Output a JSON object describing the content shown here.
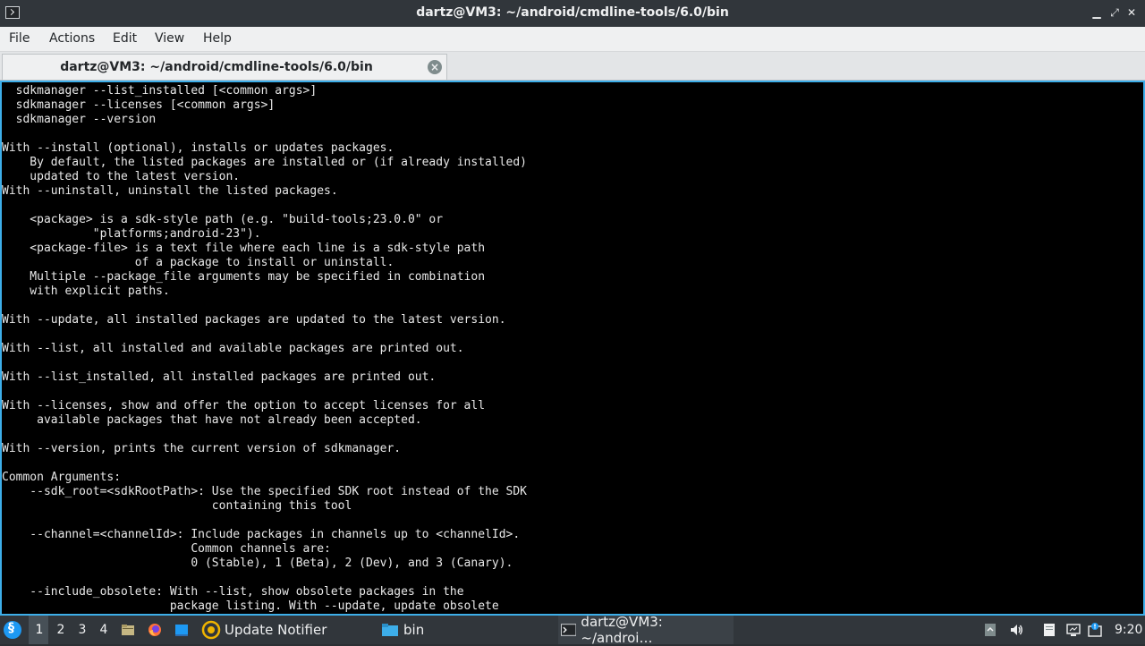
{
  "window": {
    "title": "dartz@VM3: ~/android/cmdline-tools/6.0/bin",
    "controls": {
      "minimize": "▁",
      "maximize": "⤢",
      "close": "✕"
    }
  },
  "menu": {
    "items": [
      "File",
      "Actions",
      "Edit",
      "View",
      "Help"
    ]
  },
  "tab": {
    "title": "dartz@VM3: ~/android/cmdline-tools/6.0/bin",
    "close": "×"
  },
  "terminal": {
    "lines": [
      "  sdkmanager --list_installed [<common args>]",
      "  sdkmanager --licenses [<common args>]",
      "  sdkmanager --version",
      "",
      "With --install (optional), installs or updates packages.",
      "    By default, the listed packages are installed or (if already installed)",
      "    updated to the latest version.",
      "With --uninstall, uninstall the listed packages.",
      "",
      "    <package> is a sdk-style path (e.g. \"build-tools;23.0.0\" or",
      "             \"platforms;android-23\").",
      "    <package-file> is a text file where each line is a sdk-style path",
      "                   of a package to install or uninstall.",
      "    Multiple --package_file arguments may be specified in combination",
      "    with explicit paths.",
      "",
      "With --update, all installed packages are updated to the latest version.",
      "",
      "With --list, all installed and available packages are printed out.",
      "",
      "With --list_installed, all installed packages are printed out.",
      "",
      "With --licenses, show and offer the option to accept licenses for all",
      "     available packages that have not already been accepted.",
      "",
      "With --version, prints the current version of sdkmanager.",
      "",
      "Common Arguments:",
      "    --sdk_root=<sdkRootPath>: Use the specified SDK root instead of the SDK",
      "                              containing this tool",
      "",
      "    --channel=<channelId>: Include packages in channels up to <channelId>.",
      "                           Common channels are:",
      "                           0 (Stable), 1 (Beta), 2 (Dev), and 3 (Canary).",
      "",
      "    --include_obsolete: With --list, show obsolete packages in the",
      "                        package listing. With --update, update obsolete"
    ]
  },
  "taskbar": {
    "workspaces": [
      "1",
      "2",
      "3",
      "4"
    ],
    "active_workspace": "1",
    "tasks": [
      {
        "label": "Update Notifier",
        "icon": "update-notifier-icon"
      },
      {
        "label": "bin",
        "icon": "folder-icon"
      },
      {
        "label": "dartz@VM3: ~/androi…",
        "icon": "terminal-icon"
      }
    ],
    "clock": "9:20",
    "colors": {
      "accent": "#3daee9",
      "panel": "#31363b",
      "start": "#1d99f3"
    }
  }
}
